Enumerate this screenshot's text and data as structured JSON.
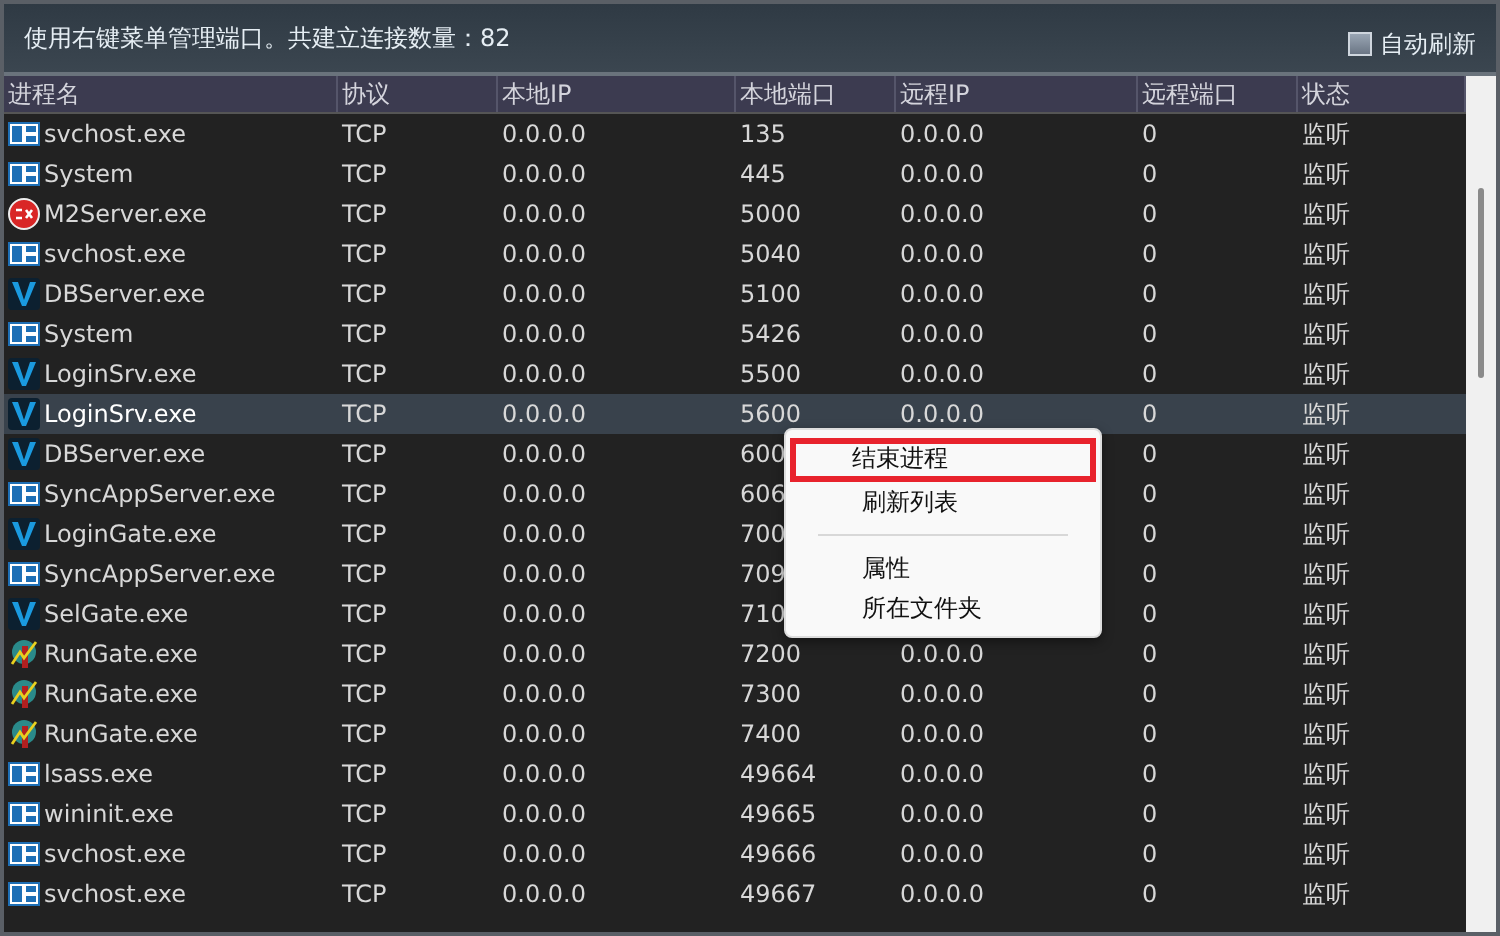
{
  "header": {
    "message": "使用右键菜单管理端口。共建立连接数量：82",
    "auto_refresh": {
      "label": "自动刷新",
      "checked": false
    }
  },
  "table": {
    "columns": [
      "进程名",
      "协议",
      "本地IP",
      "本地端口",
      "远程IP",
      "远程端口",
      "状态"
    ],
    "rows": [
      {
        "kind": "window",
        "name": "svchost.exe",
        "protocol": "TCP",
        "local_ip": "0.0.0.0",
        "local_port": "135",
        "remote_ip": "0.0.0.0",
        "remote_port": "0",
        "state": "监听",
        "selected": false
      },
      {
        "kind": "window",
        "name": "System",
        "protocol": "TCP",
        "local_ip": "0.0.0.0",
        "local_port": "445",
        "remote_ip": "0.0.0.0",
        "remote_port": "0",
        "state": "监听",
        "selected": false
      },
      {
        "kind": "dx",
        "name": "M2Server.exe",
        "protocol": "TCP",
        "local_ip": "0.0.0.0",
        "local_port": "5000",
        "remote_ip": "0.0.0.0",
        "remote_port": "0",
        "state": "监听",
        "selected": false
      },
      {
        "kind": "window",
        "name": "svchost.exe",
        "protocol": "TCP",
        "local_ip": "0.0.0.0",
        "local_port": "5040",
        "remote_ip": "0.0.0.0",
        "remote_port": "0",
        "state": "监听",
        "selected": false
      },
      {
        "kind": "v",
        "name": "DBServer.exe",
        "protocol": "TCP",
        "local_ip": "0.0.0.0",
        "local_port": "5100",
        "remote_ip": "0.0.0.0",
        "remote_port": "0",
        "state": "监听",
        "selected": false
      },
      {
        "kind": "window",
        "name": "System",
        "protocol": "TCP",
        "local_ip": "0.0.0.0",
        "local_port": "5426",
        "remote_ip": "0.0.0.0",
        "remote_port": "0",
        "state": "监听",
        "selected": false
      },
      {
        "kind": "v",
        "name": "LoginSrv.exe",
        "protocol": "TCP",
        "local_ip": "0.0.0.0",
        "local_port": "5500",
        "remote_ip": "0.0.0.0",
        "remote_port": "0",
        "state": "监听",
        "selected": false
      },
      {
        "kind": "v",
        "name": "LoginSrv.exe",
        "protocol": "TCP",
        "local_ip": "0.0.0.0",
        "local_port": "5600",
        "remote_ip": "0.0.0.0",
        "remote_port": "0",
        "state": "监听",
        "selected": true
      },
      {
        "kind": "v",
        "name": "DBServer.exe",
        "protocol": "TCP",
        "local_ip": "0.0.0.0",
        "local_port": "600",
        "remote_port": "0",
        "state": "监听",
        "selected": false
      },
      {
        "kind": "window",
        "name": "SyncAppServer.exe",
        "protocol": "TCP",
        "local_ip": "0.0.0.0",
        "local_port": "606",
        "remote_port": "0",
        "state": "监听",
        "selected": false
      },
      {
        "kind": "v",
        "name": "LoginGate.exe",
        "protocol": "TCP",
        "local_ip": "0.0.0.0",
        "local_port": "700",
        "remote_port": "0",
        "state": "监听",
        "selected": false
      },
      {
        "kind": "window",
        "name": "SyncAppServer.exe",
        "protocol": "TCP",
        "local_ip": "0.0.0.0",
        "local_port": "709",
        "remote_port": "0",
        "state": "监听",
        "selected": false
      },
      {
        "kind": "v",
        "name": "SelGate.exe",
        "protocol": "TCP",
        "local_ip": "0.0.0.0",
        "local_port": "710",
        "remote_port": "0",
        "state": "监听",
        "selected": false
      },
      {
        "kind": "gate",
        "name": "RunGate.exe",
        "protocol": "TCP",
        "local_ip": "0.0.0.0",
        "local_port": "7200",
        "remote_ip": "0.0.0.0",
        "remote_port": "0",
        "state": "监听",
        "selected": false
      },
      {
        "kind": "gate",
        "name": "RunGate.exe",
        "protocol": "TCP",
        "local_ip": "0.0.0.0",
        "local_port": "7300",
        "remote_ip": "0.0.0.0",
        "remote_port": "0",
        "state": "监听",
        "selected": false
      },
      {
        "kind": "gate",
        "name": "RunGate.exe",
        "protocol": "TCP",
        "local_ip": "0.0.0.0",
        "local_port": "7400",
        "remote_ip": "0.0.0.0",
        "remote_port": "0",
        "state": "监听",
        "selected": false
      },
      {
        "kind": "window",
        "name": "lsass.exe",
        "protocol": "TCP",
        "local_ip": "0.0.0.0",
        "local_port": "49664",
        "remote_ip": "0.0.0.0",
        "remote_port": "0",
        "state": "监听",
        "selected": false
      },
      {
        "kind": "window",
        "name": "wininit.exe",
        "protocol": "TCP",
        "local_ip": "0.0.0.0",
        "local_port": "49665",
        "remote_ip": "0.0.0.0",
        "remote_port": "0",
        "state": "监听",
        "selected": false
      },
      {
        "kind": "window",
        "name": "svchost.exe",
        "protocol": "TCP",
        "local_ip": "0.0.0.0",
        "local_port": "49666",
        "remote_ip": "0.0.0.0",
        "remote_port": "0",
        "state": "监听",
        "selected": false
      },
      {
        "kind": "window",
        "name": "svchost.exe",
        "protocol": "TCP",
        "local_ip": "0.0.0.0",
        "local_port": "49667",
        "remote_ip": "0.0.0.0",
        "remote_port": "0",
        "state": "监听",
        "selected": false
      }
    ]
  },
  "context_menu": {
    "items": [
      {
        "kind": "item",
        "label": "结束进程",
        "highlighted": true
      },
      {
        "kind": "item",
        "label": "刷新列表",
        "highlighted": false
      },
      {
        "kind": "separator"
      },
      {
        "kind": "item",
        "label": "属性",
        "highlighted": false
      },
      {
        "kind": "item",
        "label": "所在文件夹",
        "highlighted": false
      }
    ]
  }
}
